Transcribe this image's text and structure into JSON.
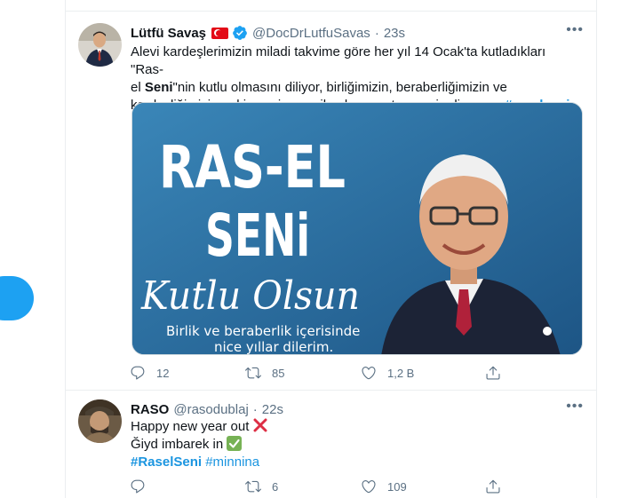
{
  "tweets": [
    {
      "name": "Lütfü Savaş",
      "handle": "@DocDrLutfuSavas",
      "dot": "·",
      "time": "23s",
      "text_lines": [
        "Alevi kardeşlerimizin miladi takvime göre her yıl 14 Ocak'ta kutladıkları \"Ras-",
        "el ",
        "Seni",
        "\"nin kutlu olmasını diliyor, birliğimizin, beraberliğimizin ve",
        "kardeşliğimizin pekişmesine vesile olmasını temenni ediyorum. ",
        "#raselseni"
      ],
      "media": {
        "title_line1": "RAS-EL",
        "title_line2": "SENi",
        "script_text": "Kutlu Olsun",
        "subtitle_line1": "Birlik ve beraberlik içerisinde",
        "subtitle_line2": "nice yıllar dilerim."
      },
      "replies": "12",
      "retweets": "85",
      "likes": "1,2 B"
    },
    {
      "name": "RASO",
      "handle": "@rasodublaj",
      "dot": "·",
      "time": "22s",
      "line1": "Happy new year out ",
      "line2": "Ğiyd imbarek in ",
      "hashtag1": "#RaselSeni",
      "hashtag2": "#minnina",
      "retweets": "6",
      "likes": "109"
    }
  ],
  "colors": {
    "accent": "#1da1f2",
    "link": "#1b95e0",
    "muted": "#5b7083",
    "border": "#ebeef0"
  },
  "icons": [
    "reply-icon",
    "retweet-icon",
    "like-icon",
    "share-icon",
    "more-icon",
    "verified-icon",
    "turkey-flag-icon",
    "cross-mark-icon",
    "check-mark-icon"
  ]
}
